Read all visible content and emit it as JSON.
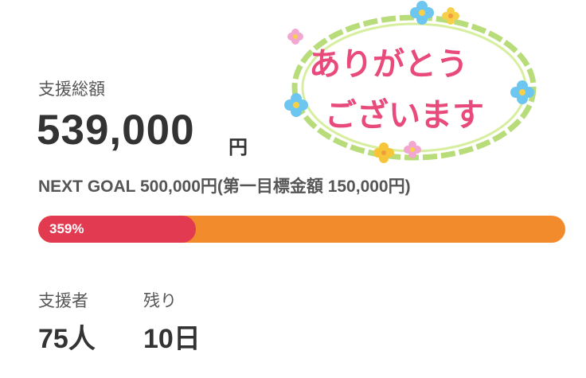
{
  "funding": {
    "total_label": "支援総額",
    "total_amount": "539,000",
    "currency_unit": "円",
    "next_goal": "NEXT GOAL 500,000円(第一目標金額 150,000円)",
    "progress_text": "359%",
    "progress_ratio": 3.59
  },
  "stats": {
    "supporters_label": "支援者",
    "supporters_value": "75人",
    "remaining_label": "残り",
    "remaining_value": "10日"
  },
  "thanks_illustration": {
    "line1": "ありがとう",
    "line2": "ございます"
  },
  "colors": {
    "progress_fill": "#e23b51",
    "progress_track": "#f28b2b",
    "thanks_text": "#e84b7b",
    "wreath": "#b7dc79"
  },
  "icons": [
    "flower-icon",
    "wreath-frame"
  ]
}
